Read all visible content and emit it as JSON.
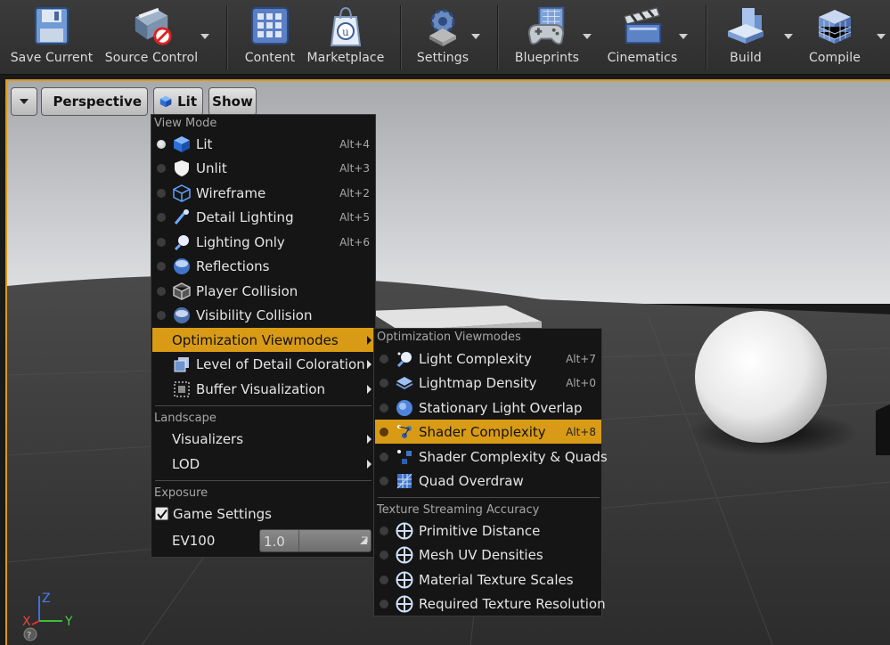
{
  "toolbar": {
    "buttons": [
      {
        "label": "Save Current",
        "icon": "floppy-disk-icon"
      },
      {
        "label": "Source Control",
        "icon": "source-control-icon"
      },
      {
        "label": "Content",
        "icon": "content-grid-icon"
      },
      {
        "label": "Marketplace",
        "icon": "marketplace-bag-icon"
      },
      {
        "label": "Settings",
        "icon": "gear-icon"
      },
      {
        "label": "Blueprints",
        "icon": "blueprints-gamepad-icon"
      },
      {
        "label": "Cinematics",
        "icon": "clapperboard-icon"
      },
      {
        "label": "Build",
        "icon": "build-blocks-icon"
      },
      {
        "label": "Compile",
        "icon": "compile-cubes-icon"
      }
    ]
  },
  "viewport": {
    "perspective_label": "Perspective",
    "lit_label": "Lit",
    "show_label": "Show",
    "accent": "#d99b16",
    "axes": {
      "z": "Z",
      "x": "X",
      "y": "Y"
    }
  },
  "viewmode_menu": {
    "sections": {
      "view_mode": "View Mode",
      "landscape": "Landscape",
      "exposure": "Exposure"
    },
    "items": [
      {
        "label": "Lit",
        "shortcut": "Alt+4",
        "selected": true,
        "icon": "lit-cube-icon"
      },
      {
        "label": "Unlit",
        "shortcut": "Alt+3",
        "selected": false,
        "icon": "unlit-shield-icon"
      },
      {
        "label": "Wireframe",
        "shortcut": "Alt+2",
        "selected": false,
        "icon": "wireframe-cube-icon"
      },
      {
        "label": "Detail Lighting",
        "shortcut": "Alt+5",
        "selected": false,
        "icon": "detail-lighting-icon"
      },
      {
        "label": "Lighting Only",
        "shortcut": "Alt+6",
        "selected": false,
        "icon": "lighting-only-icon"
      },
      {
        "label": "Reflections",
        "shortcut": "",
        "selected": false,
        "icon": "reflections-sphere-icon"
      },
      {
        "label": "Player Collision",
        "shortcut": "",
        "selected": false,
        "icon": "player-collision-icon"
      },
      {
        "label": "Visibility Collision",
        "shortcut": "",
        "selected": false,
        "icon": "visibility-collision-icon"
      }
    ],
    "submenus": [
      {
        "label": "Optimization Viewmodes",
        "highlighted": true
      },
      {
        "label": "Level of Detail Coloration",
        "icon": "lod-coloration-icon"
      },
      {
        "label": "Buffer Visualization",
        "icon": "buffer-visualization-icon"
      }
    ],
    "landscape_items": [
      {
        "label": "Visualizers"
      },
      {
        "label": "LOD"
      }
    ],
    "game_settings_label": "Game Settings",
    "game_settings_checked": true,
    "ev100_label": "EV100",
    "ev100_value": "1.0"
  },
  "optimization_menu": {
    "header": "Optimization Viewmodes",
    "items": [
      {
        "label": "Light Complexity",
        "shortcut": "Alt+7",
        "icon": "light-complexity-icon"
      },
      {
        "label": "Lightmap Density",
        "shortcut": "Alt+0",
        "icon": "lightmap-density-icon"
      },
      {
        "label": "Stationary Light Overlap",
        "shortcut": "",
        "icon": "stationary-light-overlap-icon"
      },
      {
        "label": "Shader Complexity",
        "shortcut": "Alt+8",
        "icon": "shader-complexity-icon",
        "highlighted": true
      },
      {
        "label": "Shader Complexity & Quads",
        "shortcut": "",
        "icon": "shader-complexity-quads-icon"
      },
      {
        "label": "Quad Overdraw",
        "shortcut": "",
        "icon": "quad-overdraw-icon"
      }
    ],
    "texture_header": "Texture Streaming Accuracy",
    "texture_items": [
      {
        "label": "Primitive Distance",
        "icon": "crosshair-icon"
      },
      {
        "label": "Mesh UV Densities",
        "icon": "crosshair-icon"
      },
      {
        "label": "Material Texture Scales",
        "icon": "crosshair-icon"
      },
      {
        "label": "Required Texture Resolution",
        "icon": "crosshair-icon"
      }
    ]
  }
}
